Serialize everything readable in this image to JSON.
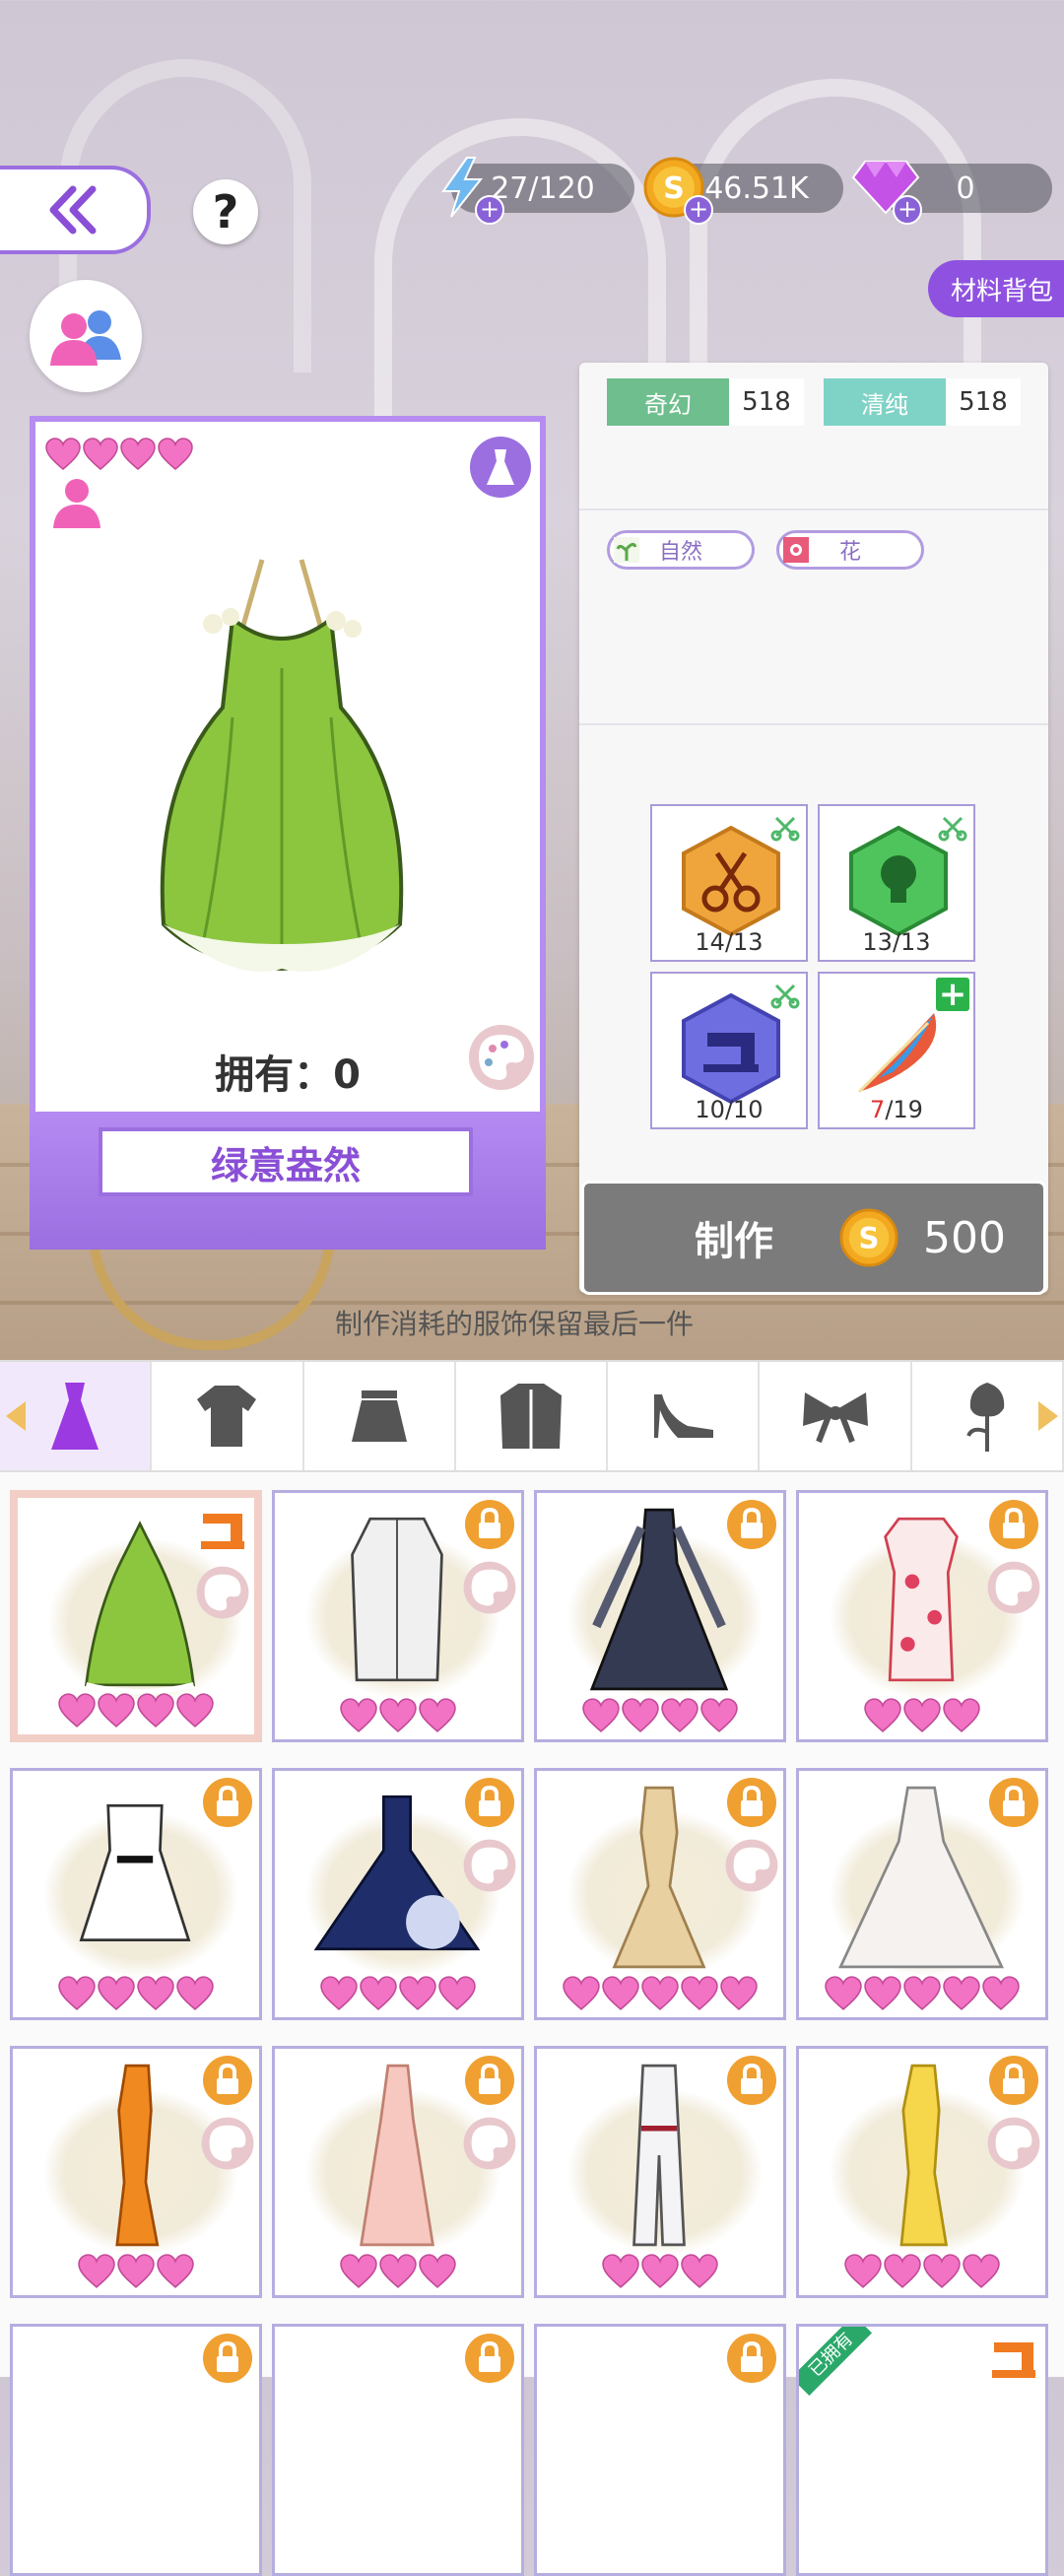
{
  "top": {
    "energy": "27/120",
    "coins": "46.51K",
    "gems": "0",
    "material_bag": "材料背包"
  },
  "item": {
    "hearts": 4,
    "own_label": "拥有：0",
    "name": "绿意盎然"
  },
  "attributes": [
    {
      "label": "奇幻",
      "value": "518",
      "color": "#6fbf8e"
    },
    {
      "label": "清纯",
      "value": "518",
      "color": "#7fd3c6"
    }
  ],
  "traits": [
    {
      "label": "自然",
      "icon": "sprout-icon"
    },
    {
      "label": "花",
      "icon": "flower-icon"
    }
  ],
  "materials": [
    {
      "icon": "scissors-hex-icon",
      "count": "14/13",
      "color": "#f0a53c"
    },
    {
      "icon": "bulb-hex-icon",
      "count": "13/13",
      "color": "#4fc45c"
    },
    {
      "icon": "sewing-machine-hex-icon",
      "count": "10/10",
      "color": "#6f6ee0"
    },
    {
      "icon": "feather-icon",
      "count_have": "7",
      "count_need": "/19"
    }
  ],
  "make": {
    "label": "制作",
    "cost": "500"
  },
  "notice": "制作消耗的服饰保留最后一件",
  "categories": [
    "dress-icon",
    "tshirt-icon",
    "skirt-icon",
    "coat-icon",
    "heels-icon",
    "bow-icon",
    "rose-icon"
  ],
  "grid": [
    {
      "name": "green-leaf-dress",
      "hearts": 4,
      "selected": true,
      "badge": "sewing-icon",
      "dye": true
    },
    {
      "name": "white-trench-coat",
      "hearts": 3,
      "lock": true,
      "dye": true
    },
    {
      "name": "dark-sleeve-gown",
      "hearts": 4,
      "lock": true,
      "dye": false
    },
    {
      "name": "floral-dress",
      "hearts": 3,
      "lock": true,
      "dye": true
    },
    {
      "name": "white-mini-dress",
      "hearts": 4,
      "lock": true,
      "dye": false
    },
    {
      "name": "starry-ball-gown",
      "hearts": 4,
      "lock": true,
      "dye": true
    },
    {
      "name": "gold-sequin-gown",
      "hearts": 5,
      "lock": true,
      "dye": true
    },
    {
      "name": "white-lace-gown",
      "hearts": 5,
      "lock": true,
      "dye": false
    },
    {
      "name": "orange-gown",
      "hearts": 3,
      "lock": true,
      "dye": true
    },
    {
      "name": "pink-halter-gown",
      "hearts": 3,
      "lock": true,
      "dye": true
    },
    {
      "name": "white-jumpsuit",
      "hearts": 3,
      "lock": true,
      "dye": false
    },
    {
      "name": "yellow-gown",
      "hearts": 4,
      "lock": true,
      "dye": true
    }
  ],
  "row4": [
    {
      "lock": true
    },
    {
      "lock": true
    },
    {
      "lock": true
    },
    {
      "owned_label": "已拥有",
      "badge": "sewing-icon"
    }
  ]
}
